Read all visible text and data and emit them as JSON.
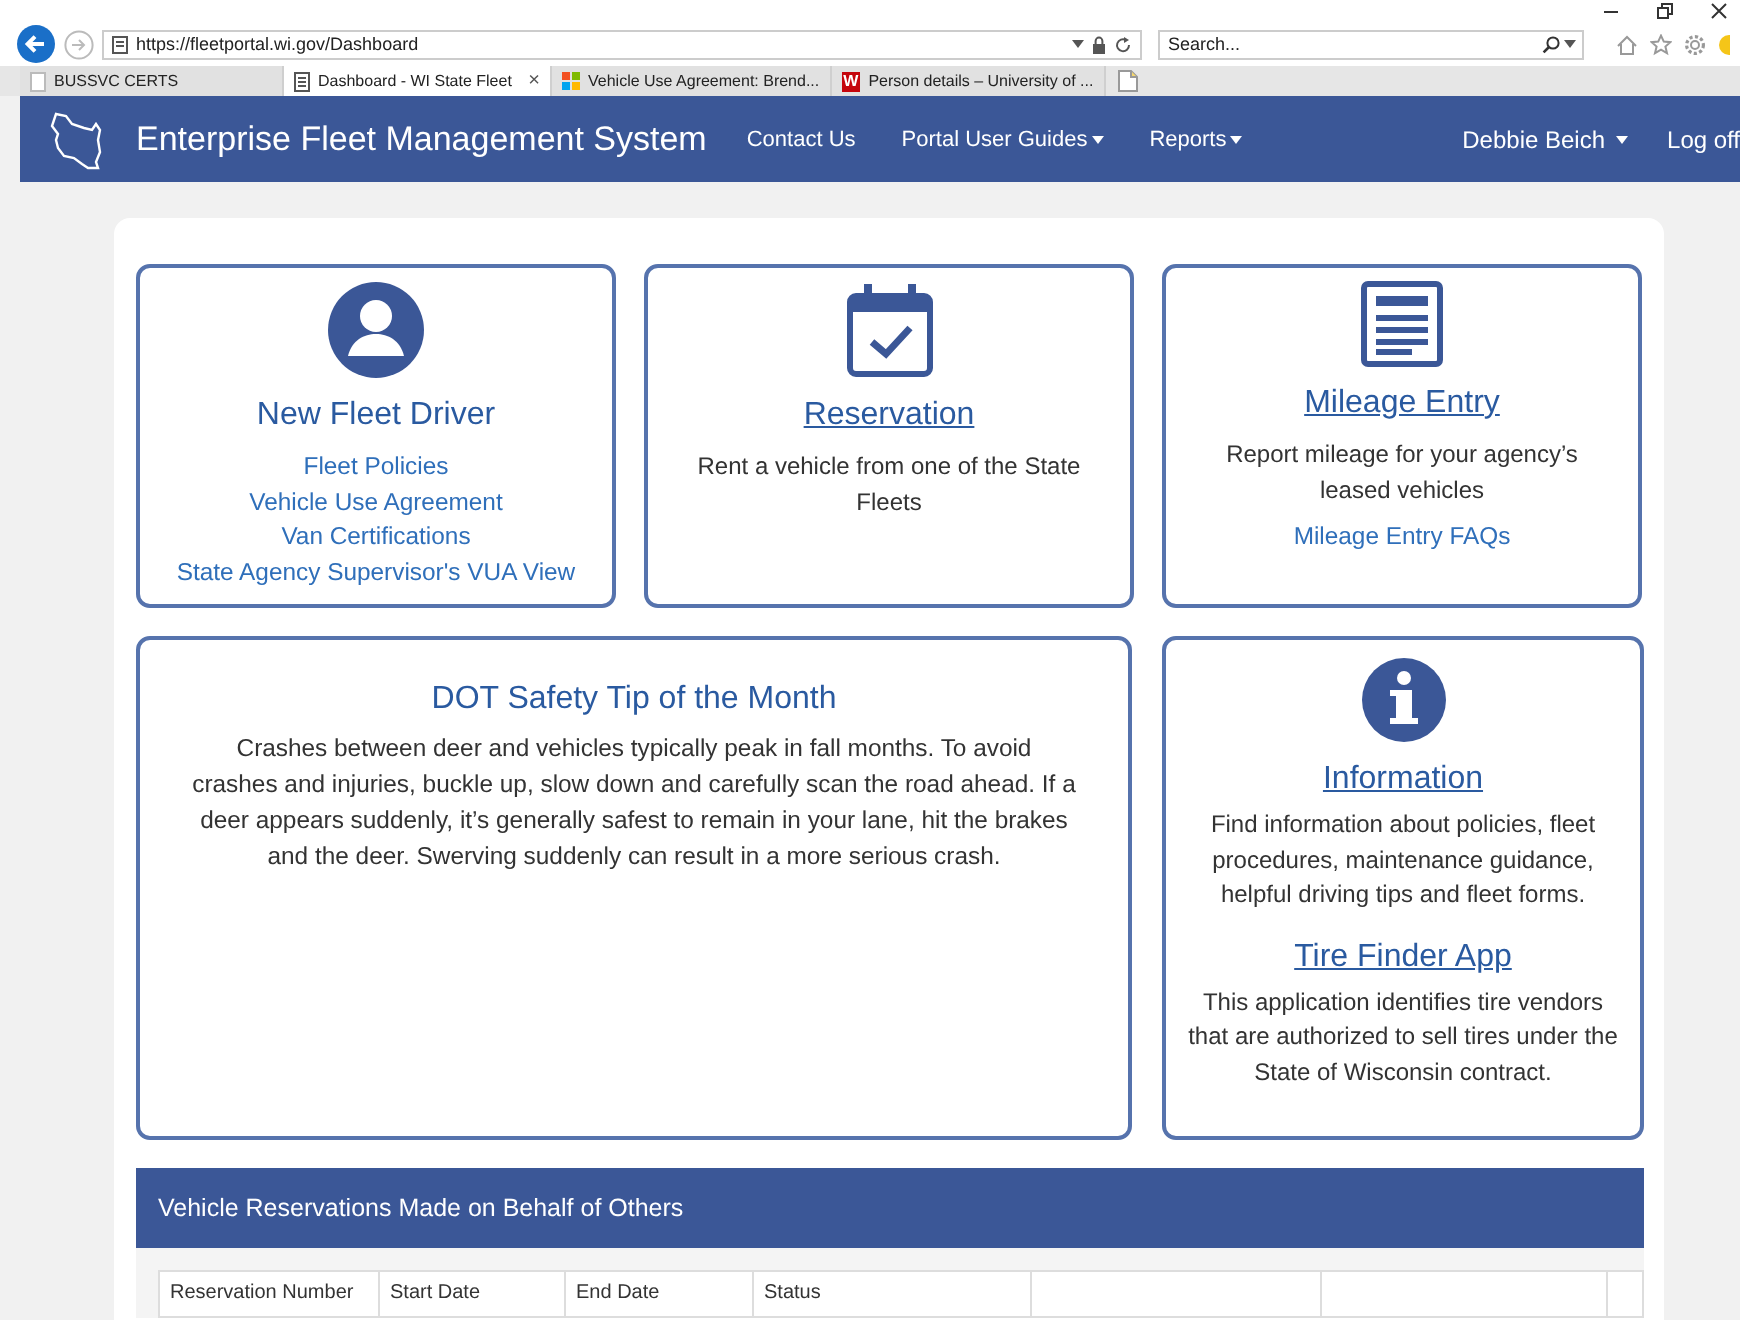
{
  "browser": {
    "address": "https://fleetportal.wi.gov/Dashboard",
    "search": {
      "placeholder": "Search..."
    },
    "tabs": [
      {
        "label": "BUSSVC CERTS",
        "selected": false,
        "kind": "blank"
      },
      {
        "label": "Dashboard - WI State Fleet",
        "selected": true,
        "kind": "page",
        "close": "×"
      },
      {
        "label": "Vehicle Use Agreement: Brend...",
        "selected": false,
        "kind": "tiles"
      },
      {
        "label": "Person details – University of ...",
        "selected": false,
        "kind": "letter",
        "icon_text": "W"
      }
    ]
  },
  "nav": {
    "brand": "Enterprise Fleet Management System",
    "links": [
      {
        "label": "Contact Us",
        "dropdown": false
      },
      {
        "label": "Portal User Guides",
        "dropdown": true
      },
      {
        "label": "Reports",
        "dropdown": true
      }
    ],
    "user": [
      {
        "label": "Debbie Beich",
        "dropdown": true
      },
      {
        "label": "Log off",
        "dropdown": false
      }
    ]
  },
  "tiles": [
    {
      "kind": "person",
      "title": "New Fleet Driver",
      "title_link": false,
      "links": [
        "Fleet Policies",
        "Vehicle Use Agreement",
        "Van Certifications",
        "State Agency Supervisor's VUA View"
      ]
    },
    {
      "kind": "calendar",
      "title": "Reservation",
      "title_link": true,
      "text": "Rent a vehicle from one of the State Fleets"
    },
    {
      "kind": "form",
      "title": "Mileage Entry",
      "title_link": true,
      "text": "Report mileage for your agency’s leased vehicles",
      "links": [
        "Mileage Entry FAQs"
      ]
    }
  ],
  "safety_tip": {
    "title": "DOT Safety Tip of the Month",
    "text": "Crashes between deer and vehicles typically peak in fall months. To avoid crashes and injuries, buckle up, slow down and carefully scan the road ahead. If a deer appears suddenly, it’s generally safest to remain in your lane, hit the brakes and the deer. Swerving suddenly can result in a more serious crash."
  },
  "info": {
    "sections": [
      {
        "title": "Information",
        "text": "Find information about policies, fleet procedures, maintenance guidance, helpful driving tips and fleet forms."
      },
      {
        "title": "Tire Finder App",
        "text": "This application identifies tire vendors that are authorized to sell tires under the State of Wisconsin contract."
      }
    ]
  },
  "reservations": {
    "title": "Vehicle Reservations Made on Behalf of Others",
    "columns": [
      "Reservation Number",
      "Start Date",
      "End Date",
      "Status"
    ]
  }
}
